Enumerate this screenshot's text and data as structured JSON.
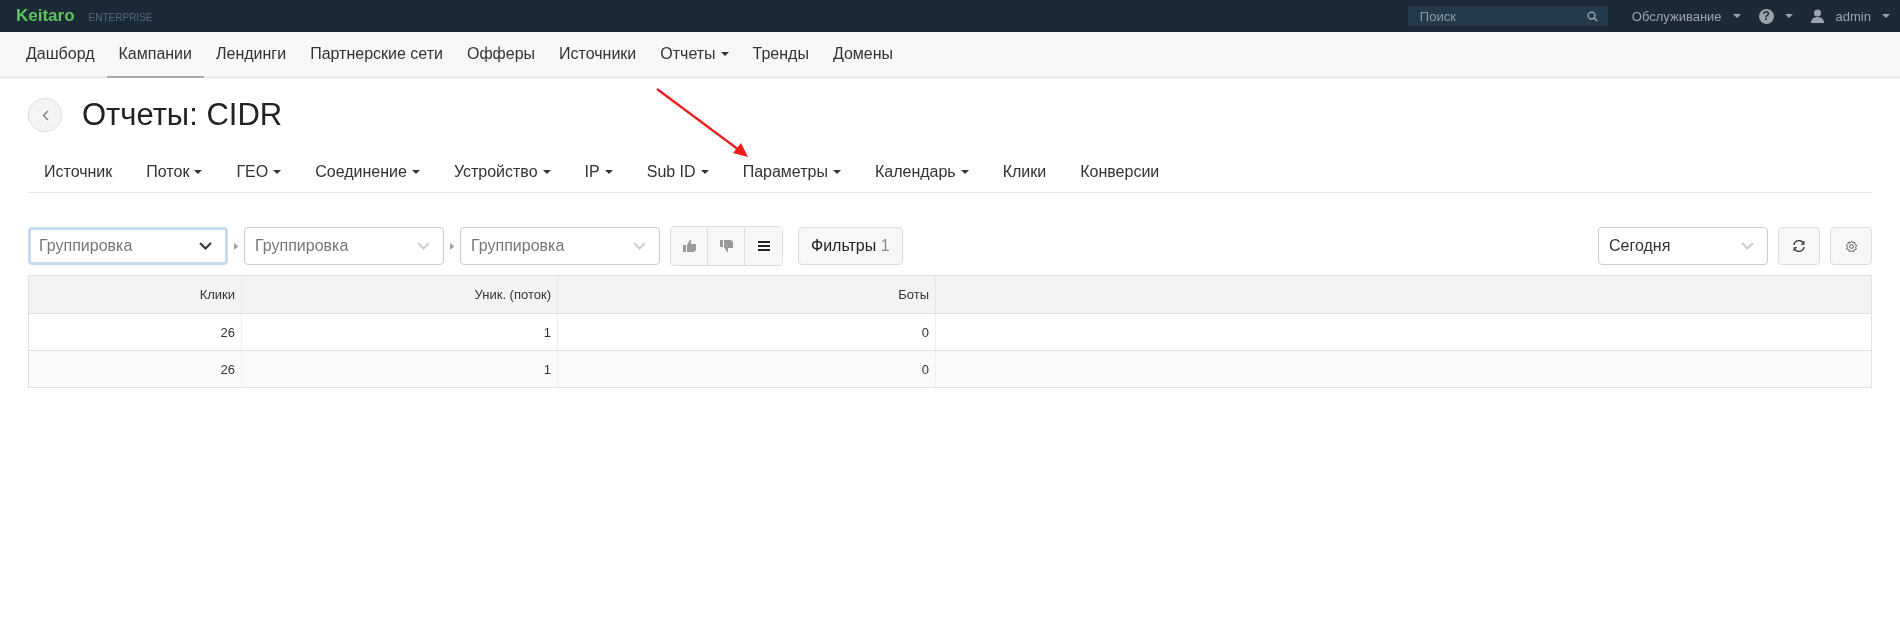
{
  "topbar": {
    "logo": "Keitaro",
    "edition": "ENTERPRISE",
    "search": {
      "placeholder": "Поиск"
    },
    "service_menu": "Обслуживание",
    "help_icon": "?",
    "user": "admin"
  },
  "nav": [
    {
      "label": "Дашборд",
      "selected": false
    },
    {
      "label": "Кампании",
      "selected": true
    },
    {
      "label": "Лендинги",
      "selected": false
    },
    {
      "label": "Партнерские сети",
      "selected": false
    },
    {
      "label": "Офферы",
      "selected": false
    },
    {
      "label": "Источники",
      "selected": false
    },
    {
      "label": "Отчеты",
      "selected": false,
      "has_caret": true
    },
    {
      "label": "Тренды",
      "selected": false
    },
    {
      "label": "Домены",
      "selected": false
    }
  ],
  "title": "Отчеты: CIDR",
  "report_tabs": [
    {
      "label": "Источник",
      "has_caret": false
    },
    {
      "label": "Поток",
      "has_caret": true
    },
    {
      "label": "ГЕО",
      "has_caret": true
    },
    {
      "label": "Соединение",
      "has_caret": true
    },
    {
      "label": "Устройство",
      "has_caret": true
    },
    {
      "label": "IP",
      "has_caret": true
    },
    {
      "label": "Sub ID",
      "has_caret": true
    },
    {
      "label": "Параметры",
      "has_caret": true
    },
    {
      "label": "Календарь",
      "has_caret": true
    },
    {
      "label": "Клики",
      "has_caret": false
    },
    {
      "label": "Конверсии",
      "has_caret": false
    }
  ],
  "groupings": [
    {
      "placeholder": "Группировка",
      "focused": true
    },
    {
      "placeholder": "Группировка",
      "focused": false
    },
    {
      "placeholder": "Группировка",
      "focused": false
    }
  ],
  "view_buttons": [
    {
      "kind": "thumbs-up",
      "selected": false
    },
    {
      "kind": "thumbs-down",
      "selected": false
    },
    {
      "kind": "list",
      "selected": true
    }
  ],
  "filters": {
    "label": "Фильтры",
    "count": "1"
  },
  "period": "Сегодня",
  "table": {
    "columns": [
      "Клики",
      "Уник. (поток)",
      "Боты"
    ],
    "rows": [
      [
        "26",
        "1",
        "0"
      ],
      [
        "26",
        "1",
        "0"
      ]
    ]
  }
}
